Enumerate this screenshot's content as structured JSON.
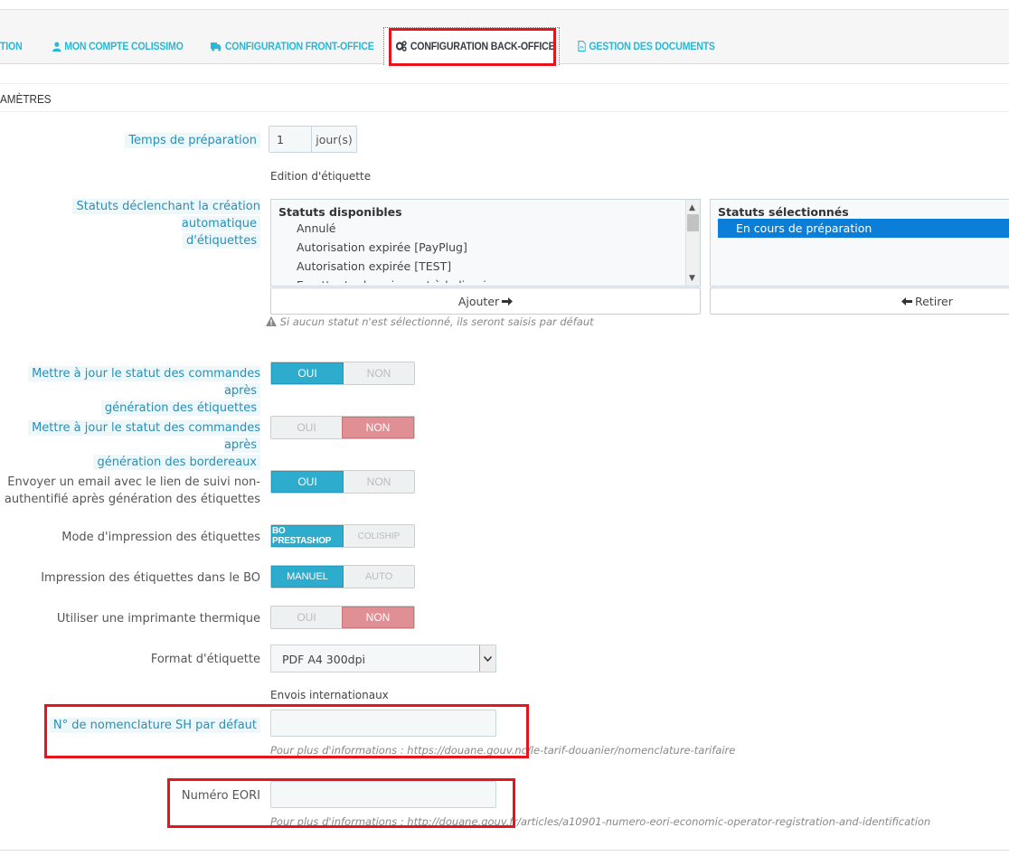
{
  "tabs": [
    {
      "label": "TION",
      "icon": "none"
    },
    {
      "label": "MON COMPTE COLISSIMO",
      "icon": "user-icon"
    },
    {
      "label": "CONFIGURATION FRONT-OFFICE",
      "icon": "truck-icon"
    },
    {
      "label": "CONFIGURATION BACK-OFFICE",
      "icon": "gears-icon",
      "active": true
    },
    {
      "label": "GESTION DES DOCUMENTS",
      "icon": "file-pdf-icon"
    }
  ],
  "panel": {
    "title": "AMÈTRES"
  },
  "prep_time": {
    "label": "Temps de préparation",
    "value": "1",
    "unit": "jour(s)"
  },
  "label_edition": {
    "title": "Edition d'étiquette"
  },
  "statuses": {
    "label_line1": "Statuts déclenchant la création automatique",
    "label_line2": "d'étiquettes",
    "available_title": "Statuts disponibles",
    "available": [
      "Annulé",
      "Autorisation expirée [PayPlug]",
      "Autorisation expirée [TEST]",
      "En attente de paiement à la livraison"
    ],
    "selected_title": "Statuts sélectionnés",
    "selected": [
      "En cours de préparation"
    ],
    "add_button": "Ajouter",
    "remove_button": "Retirer",
    "help": "Si aucun statut n'est sélectionné, ils seront saisis par défaut"
  },
  "settings": [
    {
      "line1": "Mettre à jour le statut des commandes après",
      "line2": "génération des étiquettes",
      "on": "OUI",
      "off": "NON",
      "value": "on"
    },
    {
      "line1": "Mettre à jour le statut des commandes après",
      "line2": "génération des bordereaux",
      "on": "OUI",
      "off": "NON",
      "value": "off"
    },
    {
      "line1": "Envoyer un email avec le lien de suivi non-",
      "line2": "authentifié après génération des étiquettes",
      "on": "OUI",
      "off": "NON",
      "value": "on"
    },
    {
      "line1": "Mode d'impression des étiquettes",
      "on": "BO PRESTASHOP",
      "off": "COLISHIP",
      "value": "on"
    },
    {
      "line1": "Impression des étiquettes dans le BO",
      "on": "MANUEL",
      "off": "AUTO",
      "value": "on"
    },
    {
      "line1": "Utiliser une imprimante thermique",
      "on": "OUI",
      "off": "NON",
      "value": "off"
    }
  ],
  "format": {
    "label": "Format d'étiquette",
    "value": "PDF A4 300dpi"
  },
  "international": {
    "title": "Envois internationaux",
    "sh_label": "N° de nomenclature SH par défaut",
    "sh_value": "",
    "sh_help": "Pour plus d'informations : https://douane.gouv.nc/le-tarif-douanier/nomenclature-tarifaire",
    "eori_label": "Numéro EORI",
    "eori_value": "",
    "eori_help": "Pour plus d'informations : http://douane.gouv.fr/articles/a10901-numero-eori-economic-operator-registration-and-identification"
  },
  "colors": {
    "accent": "#25b9d7",
    "on": "#2eacce",
    "off_red": "#e08f95",
    "highlight": "#e8141b"
  }
}
